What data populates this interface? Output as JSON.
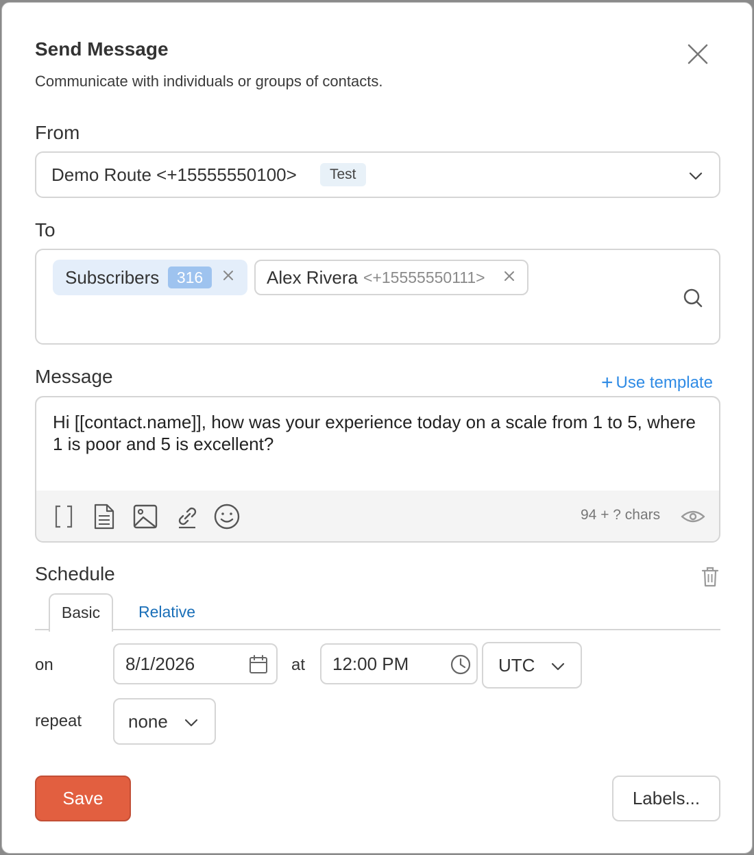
{
  "dialog": {
    "title": "Send Message",
    "subtitle": "Communicate with individuals or groups of contacts."
  },
  "from": {
    "label": "From",
    "value": "Demo Route <+15555550100>",
    "badge": "Test"
  },
  "to": {
    "label": "To",
    "chips": [
      {
        "label": "Subscribers",
        "count": "316"
      },
      {
        "name": "Alex Rivera",
        "phone": "<+15555550111>"
      }
    ]
  },
  "message": {
    "label": "Message",
    "use_template": "Use template",
    "text": "Hi [[contact.name]], how was your experience today on a scale from 1 to 5, where 1 is poor and 5 is excellent?",
    "char_count": "94 + ? chars"
  },
  "schedule": {
    "label": "Schedule",
    "tabs": [
      "Basic",
      "Relative"
    ],
    "active_tab": "Basic",
    "on_label": "on",
    "date": "8/1/2026",
    "at_label": "at",
    "time": "12:00 PM",
    "timezone": "UTC",
    "repeat_label": "repeat",
    "repeat": "none"
  },
  "actions": {
    "save": "Save",
    "labels": "Labels..."
  },
  "colors": {
    "accent": "#2f8be5",
    "save": "#e25f40",
    "chip_bg": "#e4eefa",
    "count_bg": "#9ec3ef",
    "tab_link": "#1a6fb8"
  }
}
